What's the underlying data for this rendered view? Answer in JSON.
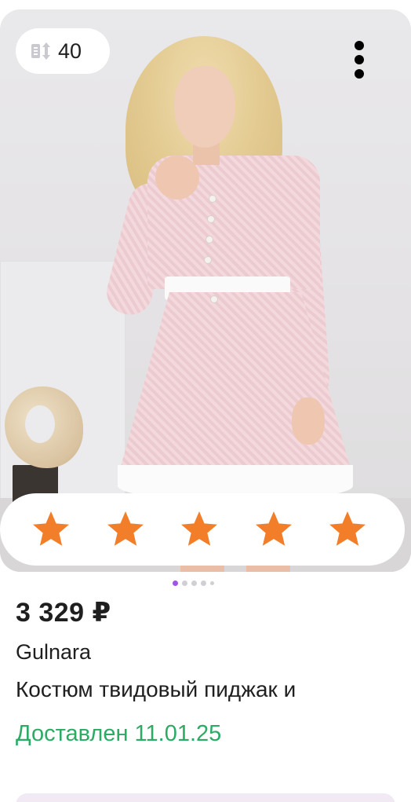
{
  "product_card": {
    "size_badge": {
      "icon": "size-arrows-icon",
      "value": "40"
    },
    "more_menu": {
      "icon": "vertical-dots-icon"
    },
    "rating": {
      "stars": 5,
      "max": 5,
      "star_color": "#f27e2a"
    },
    "gallery": {
      "image_count": 5,
      "active_index": 0,
      "active_color": "#a055e0"
    },
    "price": "3 329 ₽",
    "brand": "Gulnara",
    "title": "Костюм твидовый пиджак и",
    "delivery_status": "Доставлен 11.01.25",
    "delivery_color": "#2bab64"
  }
}
